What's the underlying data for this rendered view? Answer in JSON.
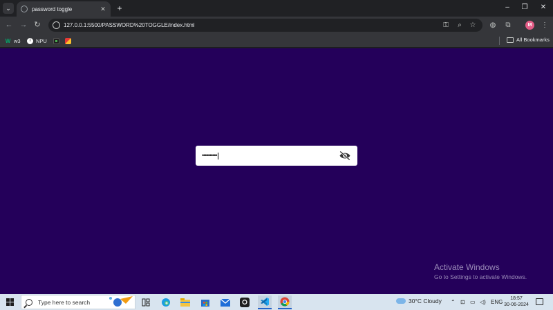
{
  "browser": {
    "tab": {
      "title": "password toggle"
    },
    "url": "127.0.0.1:5500/PASSWORD%20TOGGLE/index.html",
    "bookmarks": [
      {
        "label": "w3",
        "icon": "w3-icon",
        "color": "#04aa6d"
      },
      {
        "label": "NPU",
        "icon": "info-icon",
        "color": "#ffffff"
      }
    ],
    "all_bookmarks_label": "All Bookmarks",
    "profile_initial": "M"
  },
  "page": {
    "background": "#24005a",
    "password_field": {
      "value": "••••••••••",
      "visibility": "hidden"
    },
    "activation": {
      "title": "Activate Windows",
      "subtitle": "Go to Settings to activate Windows."
    }
  },
  "taskbar": {
    "search_placeholder": "Type here to search",
    "weather": "30°C  Cloudy",
    "language": "ENG",
    "time": "18:57",
    "date": "30-06-2024"
  }
}
